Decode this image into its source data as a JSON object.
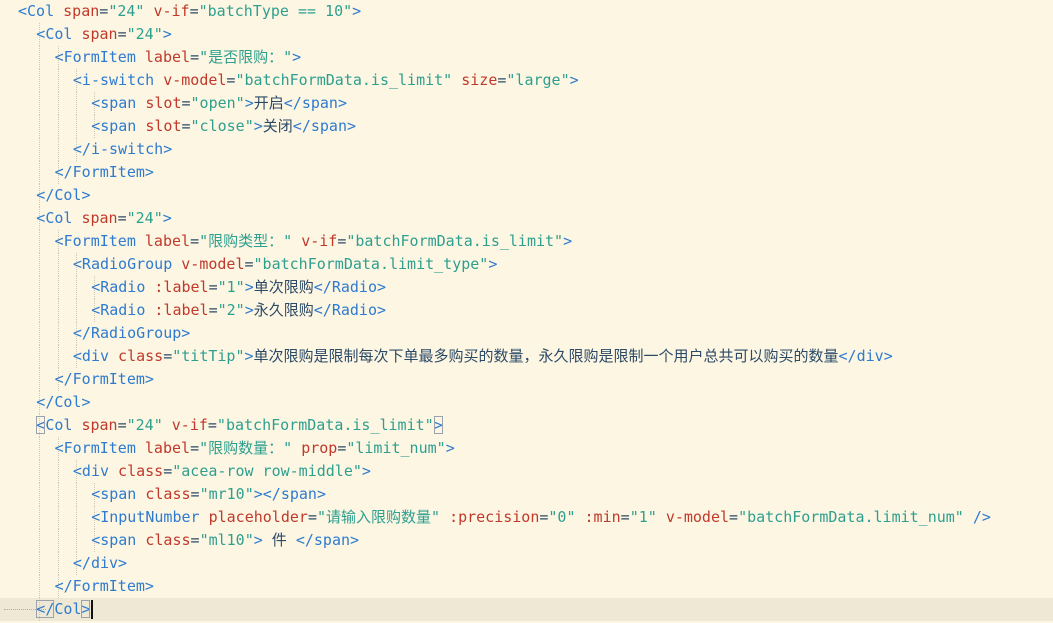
{
  "editor": {
    "language": "vue-template",
    "colors": {
      "background": "#fdf6e3",
      "current_line": "#eee8d5",
      "tag": "#2e7bcf",
      "attribute": "#c0392b",
      "string": "#2e9f8f",
      "text": "#2b4a66"
    },
    "lines": [
      {
        "indent": 0,
        "segs": [
          [
            "b",
            "<"
          ],
          [
            "t",
            "Col"
          ],
          [
            "x",
            " "
          ],
          [
            "a",
            "span"
          ],
          [
            "x",
            "="
          ],
          [
            "s",
            "\"24\""
          ],
          [
            "x",
            " "
          ],
          [
            "a",
            "v-if"
          ],
          [
            "x",
            "="
          ],
          [
            "s",
            "\"batchType == 10\""
          ],
          [
            "b",
            ">"
          ]
        ]
      },
      {
        "indent": 2,
        "segs": [
          [
            "b",
            "<"
          ],
          [
            "t",
            "Col"
          ],
          [
            "x",
            " "
          ],
          [
            "a",
            "span"
          ],
          [
            "x",
            "="
          ],
          [
            "s",
            "\"24\""
          ],
          [
            "b",
            ">"
          ]
        ]
      },
      {
        "indent": 3,
        "segs": [
          [
            "b",
            "<"
          ],
          [
            "t",
            "FormItem"
          ],
          [
            "x",
            " "
          ],
          [
            "a",
            "label"
          ],
          [
            "x",
            "="
          ],
          [
            "s",
            "\"是否限购："
          ],
          [
            "s",
            "\""
          ],
          [
            "b",
            ">"
          ]
        ]
      },
      {
        "indent": 4,
        "segs": [
          [
            "b",
            "<"
          ],
          [
            "t",
            "i-switch"
          ],
          [
            "x",
            " "
          ],
          [
            "a",
            "v-model"
          ],
          [
            "x",
            "="
          ],
          [
            "s",
            "\"batchFormData.is_limit\""
          ],
          [
            "x",
            " "
          ],
          [
            "a",
            "size"
          ],
          [
            "x",
            "="
          ],
          [
            "s",
            "\"large\""
          ],
          [
            "b",
            ">"
          ]
        ]
      },
      {
        "indent": 5,
        "segs": [
          [
            "b",
            "<"
          ],
          [
            "t",
            "span"
          ],
          [
            "x",
            " "
          ],
          [
            "a",
            "slot"
          ],
          [
            "x",
            "="
          ],
          [
            "s",
            "\"open\""
          ],
          [
            "b",
            ">"
          ],
          [
            "x",
            "开启"
          ],
          [
            "b",
            "</"
          ],
          [
            "t",
            "span"
          ],
          [
            "b",
            ">"
          ]
        ]
      },
      {
        "indent": 5,
        "segs": [
          [
            "b",
            "<"
          ],
          [
            "t",
            "span"
          ],
          [
            "x",
            " "
          ],
          [
            "a",
            "slot"
          ],
          [
            "x",
            "="
          ],
          [
            "s",
            "\"close\""
          ],
          [
            "b",
            ">"
          ],
          [
            "x",
            "关闭"
          ],
          [
            "b",
            "</"
          ],
          [
            "t",
            "span"
          ],
          [
            "b",
            ">"
          ]
        ]
      },
      {
        "indent": 4,
        "segs": [
          [
            "b",
            "</"
          ],
          [
            "t",
            "i-switch"
          ],
          [
            "b",
            ">"
          ]
        ]
      },
      {
        "indent": 3,
        "segs": [
          [
            "b",
            "</"
          ],
          [
            "t",
            "FormItem"
          ],
          [
            "b",
            ">"
          ]
        ]
      },
      {
        "indent": 2,
        "segs": [
          [
            "b",
            "</"
          ],
          [
            "t",
            "Col"
          ],
          [
            "b",
            ">"
          ]
        ]
      },
      {
        "indent": 2,
        "segs": [
          [
            "b",
            "<"
          ],
          [
            "t",
            "Col"
          ],
          [
            "x",
            " "
          ],
          [
            "a",
            "span"
          ],
          [
            "x",
            "="
          ],
          [
            "s",
            "\"24\""
          ],
          [
            "b",
            ">"
          ]
        ]
      },
      {
        "indent": 3,
        "segs": [
          [
            "b",
            "<"
          ],
          [
            "t",
            "FormItem"
          ],
          [
            "x",
            " "
          ],
          [
            "a",
            "label"
          ],
          [
            "x",
            "="
          ],
          [
            "s",
            "\"限购类型：\""
          ],
          [
            "x",
            " "
          ],
          [
            "a",
            "v-if"
          ],
          [
            "x",
            "="
          ],
          [
            "s",
            "\"batchFormData.is_limit\""
          ],
          [
            "b",
            ">"
          ]
        ]
      },
      {
        "indent": 4,
        "segs": [
          [
            "b",
            "<"
          ],
          [
            "t",
            "RadioGroup"
          ],
          [
            "x",
            " "
          ],
          [
            "a",
            "v-model"
          ],
          [
            "x",
            "="
          ],
          [
            "s",
            "\"batchFormData.limit_type\""
          ],
          [
            "b",
            ">"
          ]
        ]
      },
      {
        "indent": 5,
        "segs": [
          [
            "b",
            "<"
          ],
          [
            "t",
            "Radio"
          ],
          [
            "x",
            " "
          ],
          [
            "a",
            ":label"
          ],
          [
            "x",
            "="
          ],
          [
            "s",
            "\"1\""
          ],
          [
            "b",
            ">"
          ],
          [
            "x",
            "单次限购"
          ],
          [
            "b",
            "</"
          ],
          [
            "t",
            "Radio"
          ],
          [
            "b",
            ">"
          ]
        ]
      },
      {
        "indent": 5,
        "segs": [
          [
            "b",
            "<"
          ],
          [
            "t",
            "Radio"
          ],
          [
            "x",
            " "
          ],
          [
            "a",
            ":label"
          ],
          [
            "x",
            "="
          ],
          [
            "s",
            "\"2\""
          ],
          [
            "b",
            ">"
          ],
          [
            "x",
            "永久限购"
          ],
          [
            "b",
            "</"
          ],
          [
            "t",
            "Radio"
          ],
          [
            "b",
            ">"
          ]
        ]
      },
      {
        "indent": 4,
        "segs": [
          [
            "b",
            "</"
          ],
          [
            "t",
            "RadioGroup"
          ],
          [
            "b",
            ">"
          ]
        ]
      },
      {
        "indent": 4,
        "segs": [
          [
            "b",
            "<"
          ],
          [
            "t",
            "div"
          ],
          [
            "x",
            " "
          ],
          [
            "a",
            "class"
          ],
          [
            "x",
            "="
          ],
          [
            "s",
            "\"titTip\""
          ],
          [
            "b",
            ">"
          ],
          [
            "x",
            "单次限购是限制每次下单最多购买的数量，永久限购是限制一个用户总共可以购买的数量"
          ],
          [
            "b",
            "</"
          ],
          [
            "t",
            "div"
          ],
          [
            "b",
            ">"
          ]
        ]
      },
      {
        "indent": 3,
        "segs": [
          [
            "b",
            "</"
          ],
          [
            "t",
            "FormItem"
          ],
          [
            "b",
            ">"
          ]
        ]
      },
      {
        "indent": 2,
        "segs": [
          [
            "b",
            "</"
          ],
          [
            "t",
            "Col"
          ],
          [
            "b",
            ">"
          ]
        ]
      },
      {
        "indent": 2,
        "boxed": true,
        "segs": [
          [
            "b",
            "<"
          ],
          [
            "t",
            "Col"
          ],
          [
            "x",
            " "
          ],
          [
            "a",
            "span"
          ],
          [
            "x",
            "="
          ],
          [
            "s",
            "\"24\""
          ],
          [
            "x",
            " "
          ],
          [
            "a",
            "v-if"
          ],
          [
            "x",
            "="
          ],
          [
            "s",
            "\"batchFormData.is_limit\""
          ],
          [
            "b",
            ">"
          ]
        ]
      },
      {
        "indent": 3,
        "segs": [
          [
            "b",
            "<"
          ],
          [
            "t",
            "FormItem"
          ],
          [
            "x",
            " "
          ],
          [
            "a",
            "label"
          ],
          [
            "x",
            "="
          ],
          [
            "s",
            "\"限购数量：\""
          ],
          [
            "x",
            " "
          ],
          [
            "a",
            "prop"
          ],
          [
            "x",
            "="
          ],
          [
            "s",
            "\"limit_num\""
          ],
          [
            "b",
            ">"
          ]
        ]
      },
      {
        "indent": 4,
        "segs": [
          [
            "b",
            "<"
          ],
          [
            "t",
            "div"
          ],
          [
            "x",
            " "
          ],
          [
            "a",
            "class"
          ],
          [
            "x",
            "="
          ],
          [
            "s",
            "\"acea-row row-middle\""
          ],
          [
            "b",
            ">"
          ]
        ]
      },
      {
        "indent": 5,
        "segs": [
          [
            "b",
            "<"
          ],
          [
            "t",
            "span"
          ],
          [
            "x",
            " "
          ],
          [
            "a",
            "class"
          ],
          [
            "x",
            "="
          ],
          [
            "s",
            "\"mr10\""
          ],
          [
            "b",
            "></"
          ],
          [
            "t",
            "span"
          ],
          [
            "b",
            ">"
          ]
        ]
      },
      {
        "indent": 5,
        "segs": [
          [
            "b",
            "<"
          ],
          [
            "t",
            "InputNumber"
          ],
          [
            "x",
            " "
          ],
          [
            "a",
            "placeholder"
          ],
          [
            "x",
            "="
          ],
          [
            "s",
            "\"请输入限购数量\""
          ],
          [
            "x",
            " "
          ],
          [
            "a",
            ":precision"
          ],
          [
            "x",
            "="
          ],
          [
            "s",
            "\"0\""
          ],
          [
            "x",
            " "
          ],
          [
            "a",
            ":min"
          ],
          [
            "x",
            "="
          ],
          [
            "s",
            "\"1\""
          ],
          [
            "x",
            " "
          ],
          [
            "a",
            "v-model"
          ],
          [
            "x",
            "="
          ],
          [
            "s",
            "\"batchFormData.limit_num\""
          ],
          [
            "x",
            " "
          ],
          [
            "b",
            "/>"
          ]
        ]
      },
      {
        "indent": 5,
        "segs": [
          [
            "b",
            "<"
          ],
          [
            "t",
            "span"
          ],
          [
            "x",
            " "
          ],
          [
            "a",
            "class"
          ],
          [
            "x",
            "="
          ],
          [
            "s",
            "\"ml10\""
          ],
          [
            "b",
            ">"
          ],
          [
            "x",
            " 件 "
          ],
          [
            "b",
            "</"
          ],
          [
            "t",
            "span"
          ],
          [
            "b",
            ">"
          ]
        ]
      },
      {
        "indent": 4,
        "segs": [
          [
            "b",
            "</"
          ],
          [
            "t",
            "div"
          ],
          [
            "b",
            ">"
          ]
        ]
      },
      {
        "indent": 3,
        "segs": [
          [
            "b",
            "</"
          ],
          [
            "t",
            "FormItem"
          ],
          [
            "b",
            ">"
          ]
        ]
      },
      {
        "indent": 2,
        "current": true,
        "boxed": true,
        "segs": [
          [
            "b",
            "</"
          ],
          [
            "t",
            "Col"
          ],
          [
            "b",
            ">"
          ]
        ]
      }
    ]
  }
}
